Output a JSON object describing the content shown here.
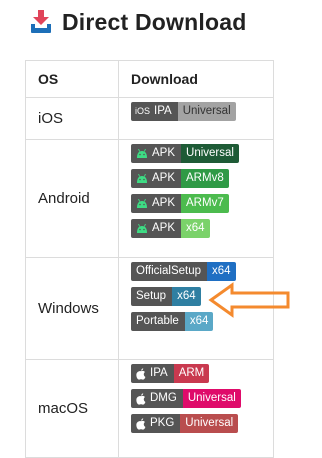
{
  "title": "Direct Download",
  "colors": {
    "title_icon": "#e0445a",
    "title_icon_tray": "#1d6fb8",
    "badge_label_bg": "#555555",
    "arrow": "#f48a2e",
    "universal_grey": "#a3a3a3",
    "android_dark": "#1e5b36",
    "android_green": "#2f9a46",
    "android_green_light": "#4cbb4e",
    "android_light": "#7bd26a",
    "windows_blue": "#1f6fc3",
    "windows_teal": "#2f7fa2",
    "windows_light": "#5aa8c7",
    "mac_red": "#c9394f",
    "mac_pink": "#df0b6a",
    "mac_brick": "#b94d4e"
  },
  "table": {
    "headers": {
      "os": "OS",
      "download": "Download"
    },
    "rows": [
      {
        "os": "iOS",
        "badges": [
          {
            "label_small": "iOS",
            "label": "IPA",
            "value": "Universal",
            "icon": "none"
          }
        ]
      },
      {
        "os": "Android",
        "badges": [
          {
            "label": "APK",
            "value": "Universal",
            "icon": "android-icon"
          },
          {
            "label": "APK",
            "value": "ARMv8",
            "icon": "android-icon"
          },
          {
            "label": "APK",
            "value": "ARMv7",
            "icon": "android-icon"
          },
          {
            "label": "APK",
            "value": "x64",
            "icon": "android-icon"
          }
        ]
      },
      {
        "os": "Windows",
        "badges": [
          {
            "label": "OfficialSetup",
            "value": "x64"
          },
          {
            "label": "Setup",
            "value": "x64"
          },
          {
            "label": "Portable",
            "value": "x64"
          }
        ]
      },
      {
        "os": "macOS",
        "badges": [
          {
            "label": "IPA",
            "value": "ARM",
            "icon": "apple-icon"
          },
          {
            "label": "DMG",
            "value": "Universal",
            "icon": "apple-icon"
          },
          {
            "label": "PKG",
            "value": "Universal",
            "icon": "apple-icon"
          }
        ]
      }
    ]
  }
}
